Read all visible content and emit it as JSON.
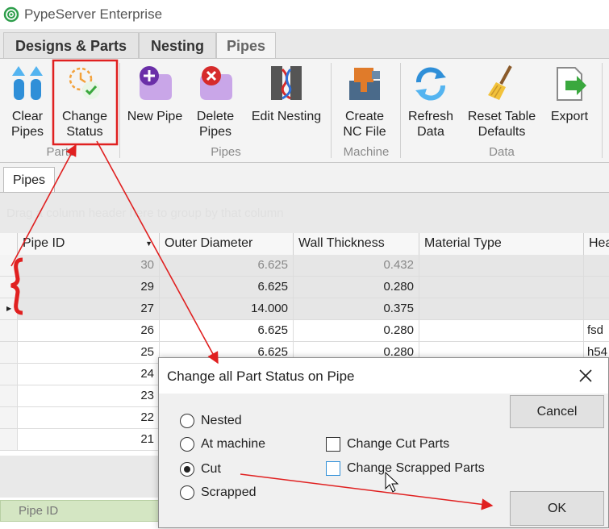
{
  "app": {
    "title": "PypeServer Enterprise"
  },
  "ribbon_tabs": [
    {
      "label": "Designs & Parts"
    },
    {
      "label": "Nesting"
    },
    {
      "label": "Pipes"
    }
  ],
  "ribbon": {
    "clear_pipes": "Clear\nPipes",
    "change_status": "Change\nStatus",
    "new_pipe": "New Pipe",
    "delete_pipes": "Delete\nPipes",
    "edit_nesting": "Edit Nesting",
    "create_nc_file": "Create\nNC File",
    "refresh_data": "Refresh\nData",
    "reset_table_defaults": "Reset Table\nDefaults",
    "export": "Export",
    "groups": {
      "parts": "Parts",
      "pipes": "Pipes",
      "machine": "Machine",
      "data": "Data"
    }
  },
  "doc_tab": "Pipes",
  "grid": {
    "group_hint": "Drag a column header here to group by that column",
    "headers": [
      "Pipe ID",
      "Outer Diameter",
      "Wall Thickness",
      "Material Type",
      "Hea"
    ],
    "rows": [
      {
        "id": "30",
        "od": "6.625",
        "wt": "0.432",
        "mat": "",
        "hea": ""
      },
      {
        "id": "29",
        "od": "6.625",
        "wt": "0.280",
        "mat": "",
        "hea": ""
      },
      {
        "id": "27",
        "od": "14.000",
        "wt": "0.375",
        "mat": "",
        "hea": ""
      },
      {
        "id": "26",
        "od": "6.625",
        "wt": "0.280",
        "mat": "",
        "hea": "fsd"
      },
      {
        "id": "25",
        "od": "6.625",
        "wt": "0.280",
        "mat": "",
        "hea": "h54"
      },
      {
        "id": "24",
        "od": "",
        "wt": "",
        "mat": "",
        "hea": ""
      },
      {
        "id": "23",
        "od": "",
        "wt": "",
        "mat": "",
        "hea": ""
      },
      {
        "id": "22",
        "od": "",
        "wt": "",
        "mat": "",
        "hea": ""
      },
      {
        "id": "21",
        "od": "",
        "wt": "",
        "mat": "",
        "hea": ""
      }
    ],
    "bottom_header": "Pipe ID"
  },
  "dialog": {
    "title": "Change all Part Status on Pipe",
    "radios": [
      {
        "label": "Nested",
        "checked": false
      },
      {
        "label": "At machine",
        "checked": false
      },
      {
        "label": "Cut",
        "checked": true
      },
      {
        "label": "Scrapped",
        "checked": false
      }
    ],
    "checkboxes": [
      {
        "label": "Change Cut Parts",
        "checked": false
      },
      {
        "label": "Change Scrapped Parts",
        "checked": false
      }
    ],
    "cancel": "Cancel",
    "ok": "OK"
  },
  "colors": {
    "annotation_red": "#e02020",
    "ribbon_bg": "#f4f4f4",
    "selected_row": "#e6e6e6"
  }
}
